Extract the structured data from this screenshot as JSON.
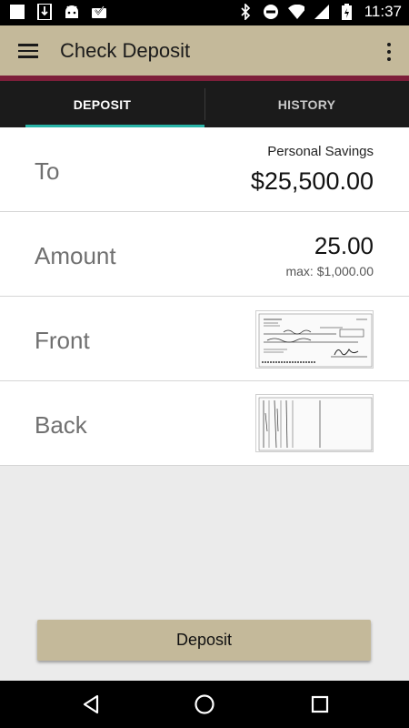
{
  "status_bar": {
    "time": "11:37",
    "left_icons": [
      "notification-square-icon",
      "download-icon",
      "android-icon",
      "checkbox-tray-icon"
    ],
    "right_icons": [
      "bluetooth-icon",
      "do-not-disturb-icon",
      "wifi-icon",
      "signal-icon",
      "battery-charging-icon"
    ]
  },
  "app_bar": {
    "title": "Check Deposit",
    "menu_icon": "hamburger-menu-icon",
    "overflow_icon": "more-vert-icon"
  },
  "tabs": [
    {
      "label": "DEPOSIT",
      "active": true
    },
    {
      "label": "HISTORY",
      "active": false
    }
  ],
  "form": {
    "to": {
      "label": "To",
      "account_name": "Personal Savings",
      "balance": "$25,500.00"
    },
    "amount": {
      "label": "Amount",
      "value": "25.00",
      "max_text": "max: $1,000.00"
    },
    "front": {
      "label": "Front",
      "image": "check-front-thumbnail"
    },
    "back": {
      "label": "Back",
      "image": "check-back-thumbnail"
    }
  },
  "deposit_button": {
    "label": "Deposit"
  },
  "nav_bar": {
    "icons": [
      "back-triangle-icon",
      "home-circle-icon",
      "recents-square-icon"
    ]
  },
  "colors": {
    "app_bar": "#c4b99a",
    "accent_stripe": "#7d1f3a",
    "tab_bar": "#1b1b1b",
    "tab_indicator": "#29b4a8",
    "button": "#c4b99a"
  }
}
